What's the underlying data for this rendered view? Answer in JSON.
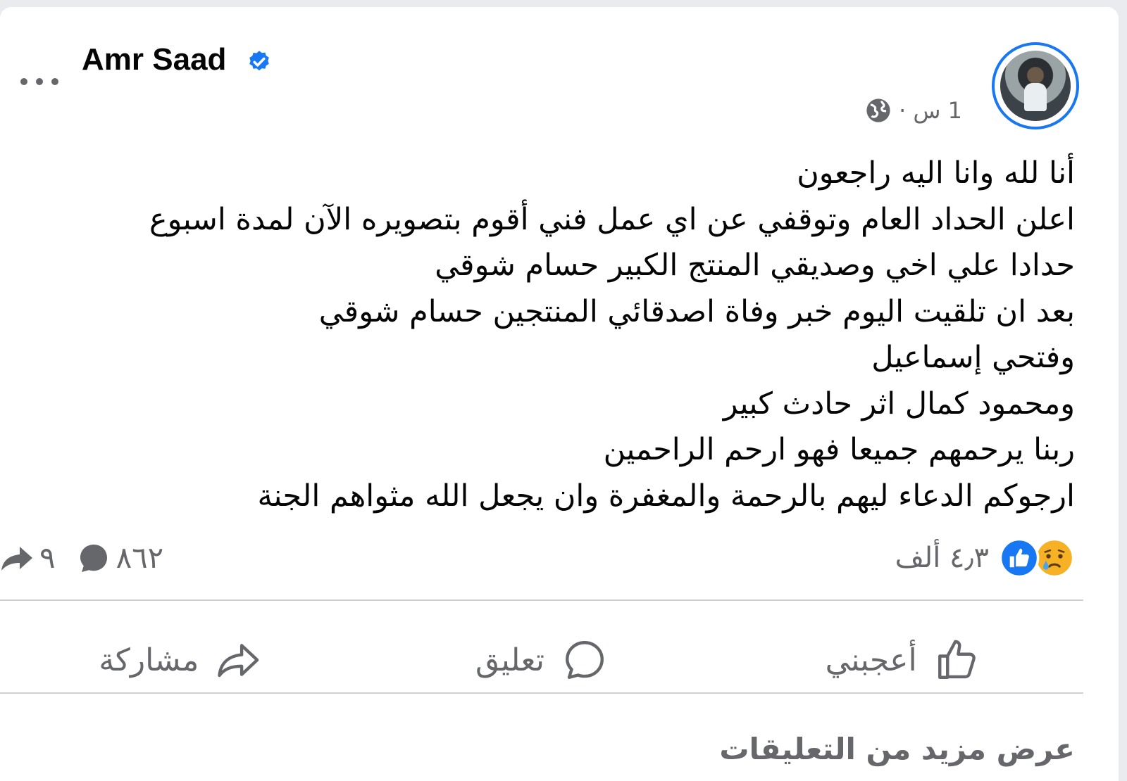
{
  "post": {
    "author": "Amr Saad",
    "verified": true,
    "time": "1 س ·",
    "audience_icon": "globe-icon",
    "more_icon": "more-options-icon",
    "lines": [
      "أنا لله وانا اليه راجعون",
      "اعلن الحداد العام وتوقفي عن اي عمل فني أقوم بتصويره الآن لمدة اسبوع",
      "حدادا علي اخي وصديقي المنتج الكبير حسام شوقي",
      "بعد ان تلقيت اليوم خبر وفاة اصدقائي المنتجين حسام شوقي",
      "وفتحي إسماعيل",
      "ومحمود كمال  اثر حادث كبير",
      "ربنا يرحمهم جميعا فهو ارحم الراحمين",
      "ارجوكم الدعاء ليهم بالرحمة والمغفرة وان يجعل الله مثواهم الجنة"
    ]
  },
  "stats": {
    "reactions_count": "٤٫٣ ألف",
    "reaction_icons": [
      "sad-reaction-icon",
      "like-reaction-icon"
    ],
    "comments_count": "٨٦٢",
    "shares_count": "٩"
  },
  "actions": {
    "like_label": "أعجبني",
    "comment_label": "تعليق",
    "share_label": "مشاركة"
  },
  "footer": {
    "more_comments": "عرض مزيد من التعليقات"
  },
  "colors": {
    "accent": "#1877f2",
    "secondary_text": "#65676b",
    "divider": "#ced0d4",
    "sad_reaction": "#f7b125"
  }
}
